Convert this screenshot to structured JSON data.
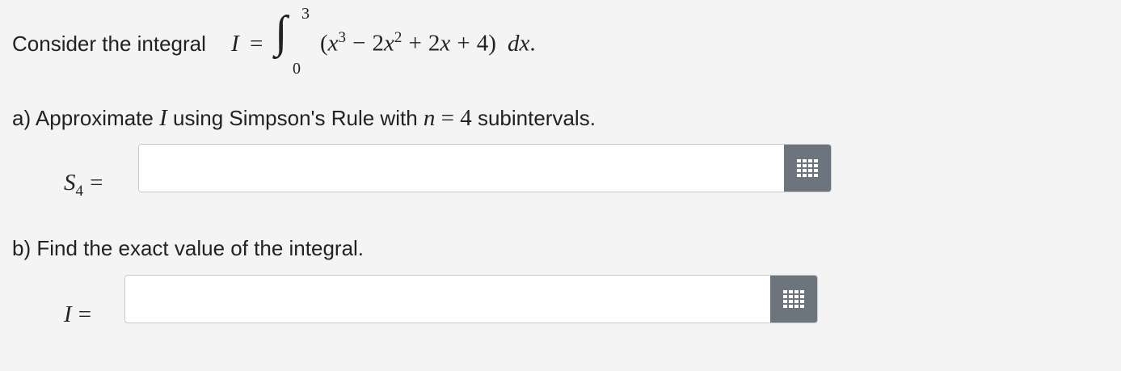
{
  "intro": {
    "text": "Consider the integral",
    "var": "I",
    "eq": "=",
    "integral_sign": "∫",
    "upper": "3",
    "lower": "0",
    "lparen": "(",
    "x1": "x",
    "exp3": "3",
    "minus": "−",
    "coef2": "2",
    "x2": "x",
    "exp2": "2",
    "plus1": "+",
    "coef2b": "2",
    "x3": "x",
    "plus2": "+",
    "four": "4",
    "rparen": ")",
    "d": "d",
    "x4": "x",
    "period": "."
  },
  "part_a": {
    "prefix": "a) Approximate",
    "var": "I",
    "mid": "using Simpson's Rule with",
    "n": "n",
    "eq": "=",
    "n_value": "4",
    "suffix": "subintervals.",
    "label_S": "S",
    "label_sub": "4",
    "label_eq": "=",
    "input_value": "",
    "input_placeholder": "",
    "keypad_icon": "keypad-grid-icon"
  },
  "part_b": {
    "prefix": "b) Find the exact value of the integral.",
    "label_I": "I",
    "label_eq": "=",
    "input_value": "",
    "input_placeholder": "",
    "keypad_icon": "keypad-grid-icon"
  },
  "colors": {
    "background": "#f4f4f4",
    "button": "#6c757d",
    "input_border": "#c9c9c9",
    "text": "#222222"
  }
}
